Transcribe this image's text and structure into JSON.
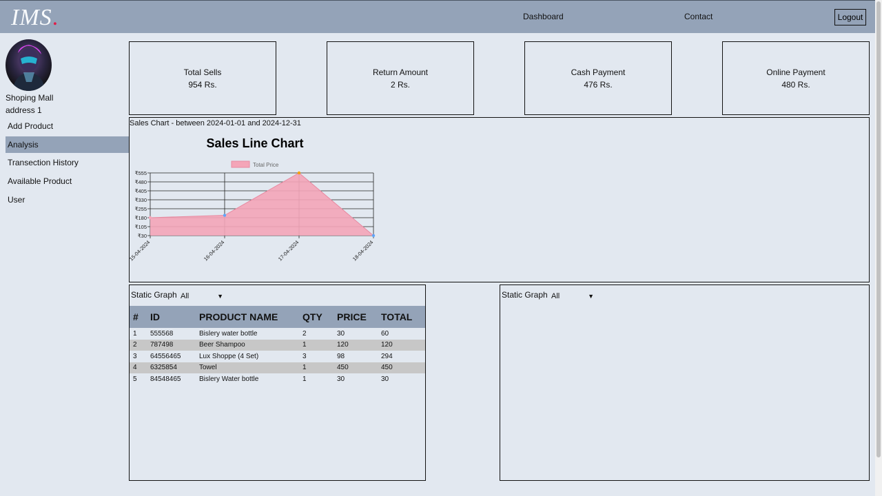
{
  "header": {
    "logo_text": "IMS",
    "logo_dot": ".",
    "nav": [
      "Dashboard",
      "Contact"
    ],
    "logout_label": "Logout"
  },
  "sidebar": {
    "shop_name": "Shoping Mall",
    "shop_address": "address 1",
    "items": [
      {
        "label": "Add Product",
        "active": false
      },
      {
        "label": "Analysis",
        "active": true
      },
      {
        "label": "Transection History",
        "active": false
      },
      {
        "label": "Available Product",
        "active": false
      },
      {
        "label": "User",
        "active": false
      }
    ]
  },
  "stats": [
    {
      "label": "Total Sells",
      "value": "954 Rs."
    },
    {
      "label": "Return Amount",
      "value": "2 Rs."
    },
    {
      "label": "Cash Payment",
      "value": "476 Rs."
    },
    {
      "label": "Online Payment",
      "value": "480 Rs."
    }
  ],
  "chart_caption": "Sales Chart - between 2024-01-01 and 2024-12-31",
  "chart_data": {
    "type": "area",
    "title": "Sales Line Chart",
    "categories": [
      "15-04-2024",
      "16-04-2024",
      "17-04-2024",
      "18-04-2024"
    ],
    "series": [
      {
        "name": "Total Price",
        "values": [
          180,
          200,
          555,
          30
        ]
      }
    ],
    "y_ticks": [
      "₹555",
      "₹480",
      "₹405",
      "₹330",
      "₹255",
      "₹180",
      "₹105",
      "₹30"
    ],
    "ylim": [
      30,
      555
    ],
    "legend": "top",
    "grid": true,
    "colors": {
      "fill": "#f4a5b8",
      "line": "#e889a0"
    }
  },
  "panels": {
    "left": {
      "title": "Static Graph",
      "select_value": "All"
    },
    "right": {
      "title": "Static Graph",
      "select_value": "All"
    }
  },
  "table": {
    "headers": [
      "#",
      "ID",
      "PRODUCT NAME",
      "QTY",
      "PRICE",
      "TOTAL"
    ],
    "rows": [
      [
        "1",
        "555568",
        "Bislery water bottle",
        "2",
        "30",
        "60"
      ],
      [
        "2",
        "787498",
        "Beer Shampoo",
        "1",
        "120",
        "120"
      ],
      [
        "3",
        "64556465",
        "Lux Shoppe (4 Set)",
        "3",
        "98",
        "294"
      ],
      [
        "4",
        "6325854",
        "Towel",
        "1",
        "450",
        "450"
      ],
      [
        "5",
        "84548465",
        "Bislery Water bottle",
        "1",
        "30",
        "30"
      ]
    ]
  },
  "colors": {
    "header_bg": "#94a3b8",
    "page_bg": "#e2e8f0",
    "accent_dot": "#e11d48"
  }
}
